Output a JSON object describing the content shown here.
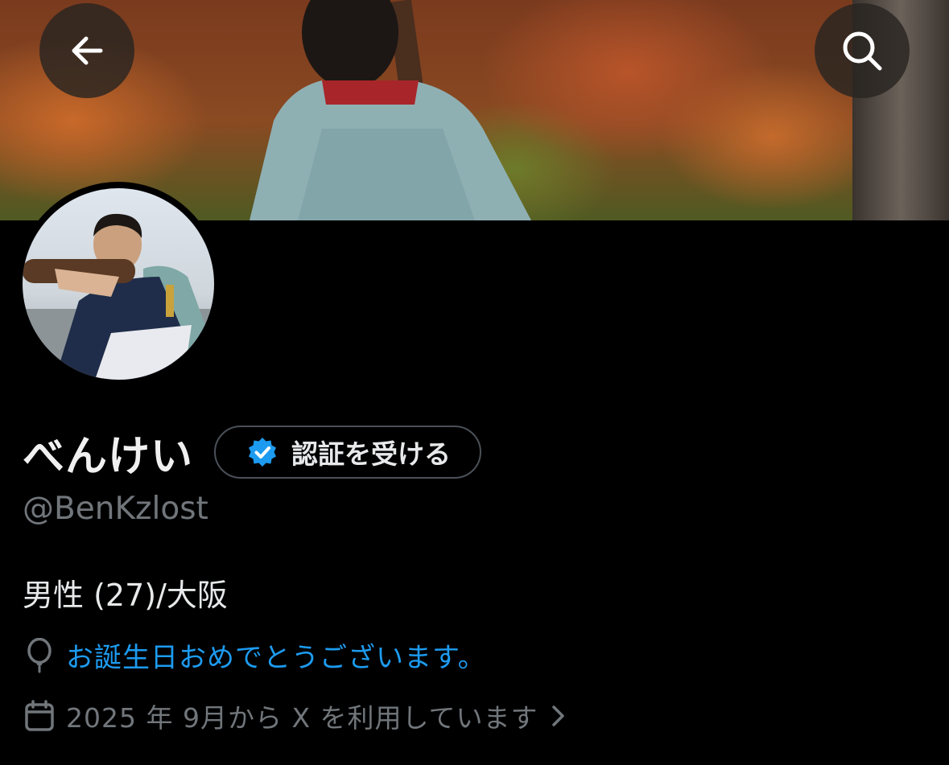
{
  "colors": {
    "background": "#000000",
    "link": "#1d9bf0",
    "muted": "#71767b",
    "verified": "#1d9bf0"
  },
  "header": {
    "back_icon": "arrow-left-icon",
    "search_icon": "search-icon"
  },
  "profile": {
    "display_name": "べんけい",
    "verify_button_label": "認証を受ける",
    "handle": "@BenKzlost",
    "bio": "男性 (27)/大阪",
    "birthday_text": "お誕生日おめでとうございます。",
    "joined_text": "2025 年 9月から X を利用しています"
  }
}
